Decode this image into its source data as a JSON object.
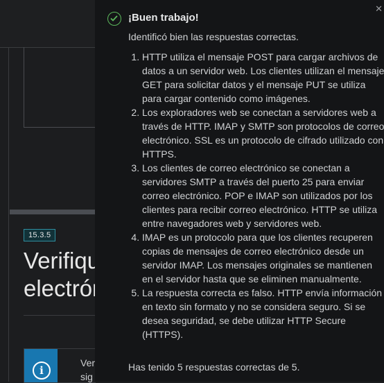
{
  "background": {
    "badge": "15.3.5",
    "heading_line1": "Verifique",
    "heading_line2": "electrónico",
    "info_line1": "Ver",
    "info_line2": "sig",
    "info_icon": "info-icon"
  },
  "feedback": {
    "icon": "check-circle-icon",
    "close_glyph": "✕",
    "title": "¡Buen trabajo!",
    "intro": "Identificó bien las respuestas correctas.",
    "answers": [
      "HTTP utiliza el mensaje POST para cargar archivos de datos a un servidor web. Los clientes utilizan el mensaje GET para solicitar datos y el mensaje PUT se utiliza para cargar contenido como imágenes.",
      "Los exploradores web se conectan a servidores web a través de HTTP. IMAP y SMTP son protocolos de correo electrónico. SSL es un protocolo de cifrado utilizado con HTTPS.",
      "Los clientes de correo electrónico se conectan a servidores SMTP a través del puerto 25 para enviar correo electrónico. POP e IMAP son utilizados por los clientes para recibir correo electrónico. HTTP se utiliza entre navegadores web y servidores web.",
      "IMAP es un protocolo para que los clientes recuperen copias de mensajes de correo electrónico desde un servidor IMAP. Los mensajes originales se mantienen en el servidor hasta que se eliminen manualmente.",
      "La respuesta correcta es falso. HTTP envía información en texto sin formato y no se considera seguro. Si se desea seguridad, se debe utilizar HTTP Secure (HTTPS)."
    ],
    "score": "Has tenido 5 respuestas correctas de 5."
  },
  "colors": {
    "success": "#5cb85c",
    "info": "#1877b0",
    "badge_border": "#2f8fa0"
  }
}
